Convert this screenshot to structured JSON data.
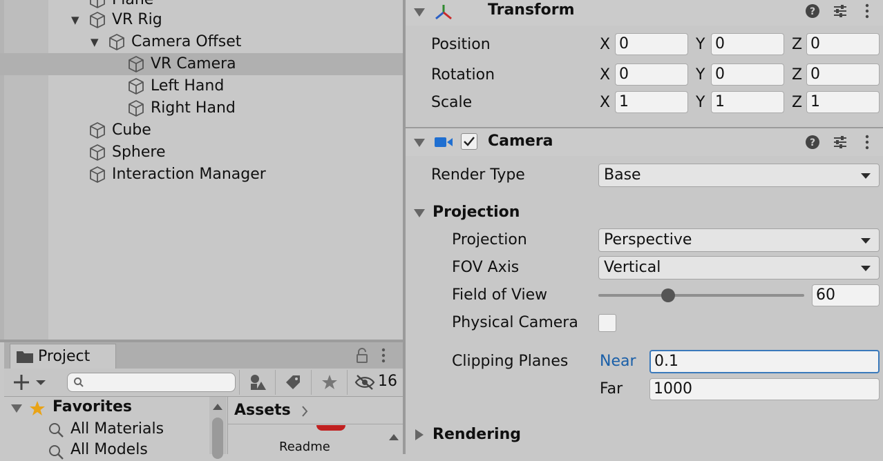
{
  "hierarchy": {
    "items": [
      {
        "label": "Plane"
      },
      {
        "label": "VR Rig"
      },
      {
        "label": "Camera Offset"
      },
      {
        "label": "VR Camera"
      },
      {
        "label": "Left Hand"
      },
      {
        "label": "Right Hand"
      },
      {
        "label": "Cube"
      },
      {
        "label": "Sphere"
      },
      {
        "label": "Interaction Manager"
      }
    ]
  },
  "project": {
    "tab_label": "Project",
    "search_placeholder": "",
    "hidden_count": "16",
    "favorites": {
      "header": "Favorites",
      "items": [
        {
          "label": "All Materials"
        },
        {
          "label": "All Models"
        }
      ]
    },
    "assets": {
      "breadcrumb": "Assets",
      "items": [
        {
          "label": "Readme"
        }
      ]
    }
  },
  "inspector": {
    "transform": {
      "title": "Transform",
      "rows": [
        {
          "label": "Position",
          "x": "0",
          "y": "0",
          "z": "0"
        },
        {
          "label": "Rotation",
          "x": "0",
          "y": "0",
          "z": "0"
        },
        {
          "label": "Scale",
          "x": "1",
          "y": "1",
          "z": "1"
        }
      ],
      "axis_labels": {
        "x": "X",
        "y": "Y",
        "z": "Z"
      }
    },
    "camera": {
      "title": "Camera",
      "enabled": true,
      "render_type_label": "Render Type",
      "render_type_value": "Base",
      "projection_section": "Projection",
      "projection_label": "Projection",
      "projection_value": "Perspective",
      "fov_axis_label": "FOV Axis",
      "fov_axis_value": "Vertical",
      "fov_label": "Field of View",
      "fov_value": "60",
      "fov_slider_fraction": 0.34,
      "physical_camera_label": "Physical Camera",
      "physical_camera_checked": false,
      "clipping_label": "Clipping Planes",
      "near_label": "Near",
      "near_value": "0.1",
      "far_label": "Far",
      "far_value": "1000",
      "rendering_section": "Rendering"
    }
  },
  "colors": {
    "panel_bg": "#c8c8c8",
    "selection": "#b0b0b0",
    "near_label_blue": "#1a5fa8",
    "focus_border": "#3a79bb",
    "camera_icon_blue": "#1f6fd1",
    "star_gold": "#e8a317"
  }
}
